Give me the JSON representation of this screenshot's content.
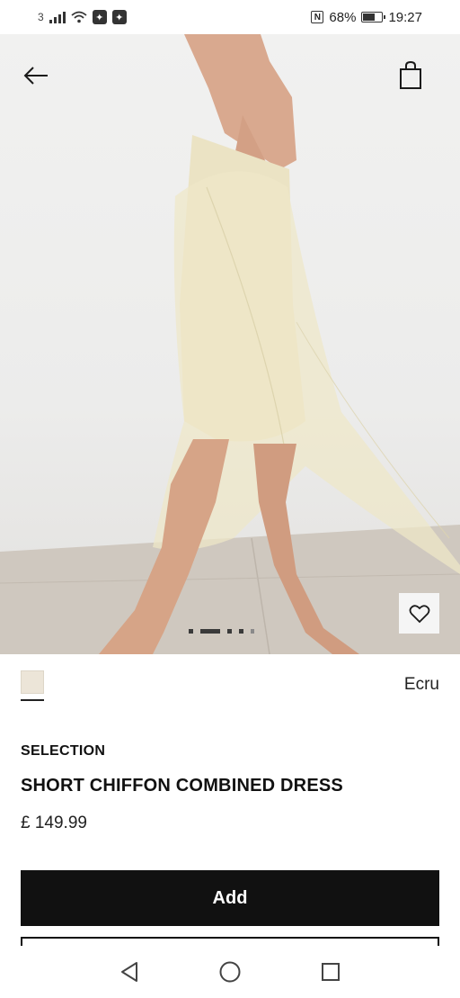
{
  "status_bar": {
    "sim_label": "3",
    "battery_percent": "68%",
    "battery_level": 0.68,
    "time": "19:27",
    "nfc_label": "N"
  },
  "icons": {
    "back": "arrow-left-icon",
    "bag": "shopping-bag-icon",
    "favorite": "heart-icon"
  },
  "carousel": {
    "slide_count": 5,
    "active_index": 1
  },
  "product": {
    "color_swatch": "#ece5d8",
    "color_name": "Ecru",
    "collection": "SELECTION",
    "title": "SHORT CHIFFON COMBINED DRESS",
    "price": "£ 149.99"
  },
  "actions": {
    "add_label": "Add"
  }
}
